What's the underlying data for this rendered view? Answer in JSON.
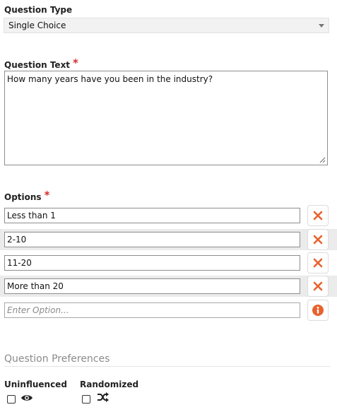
{
  "question_type": {
    "label": "Question Type",
    "selected": "Single Choice"
  },
  "question_text": {
    "label": "Question Text",
    "required_mark": "*",
    "value": "How many years have you been in the industry?"
  },
  "options": {
    "label": "Options",
    "required_mark": "*",
    "items": [
      {
        "value": "Less than 1",
        "action_icon": "close-icon"
      },
      {
        "value": "2-10",
        "action_icon": "close-icon"
      },
      {
        "value": "11-20",
        "action_icon": "close-icon"
      },
      {
        "value": "More than 20",
        "action_icon": "close-icon"
      }
    ],
    "new_option_placeholder": "Enter Option...",
    "new_option_icon": "info-icon"
  },
  "preferences": {
    "title": "Question Preferences",
    "uninfluenced": {
      "label": "Uninfluenced",
      "checked": false,
      "icon": "eye-icon"
    },
    "randomized": {
      "label": "Randomized",
      "checked": false,
      "icon": "shuffle-icon"
    }
  },
  "colors": {
    "accent_orange": "#e8622c",
    "required_red": "#d32f2f"
  }
}
